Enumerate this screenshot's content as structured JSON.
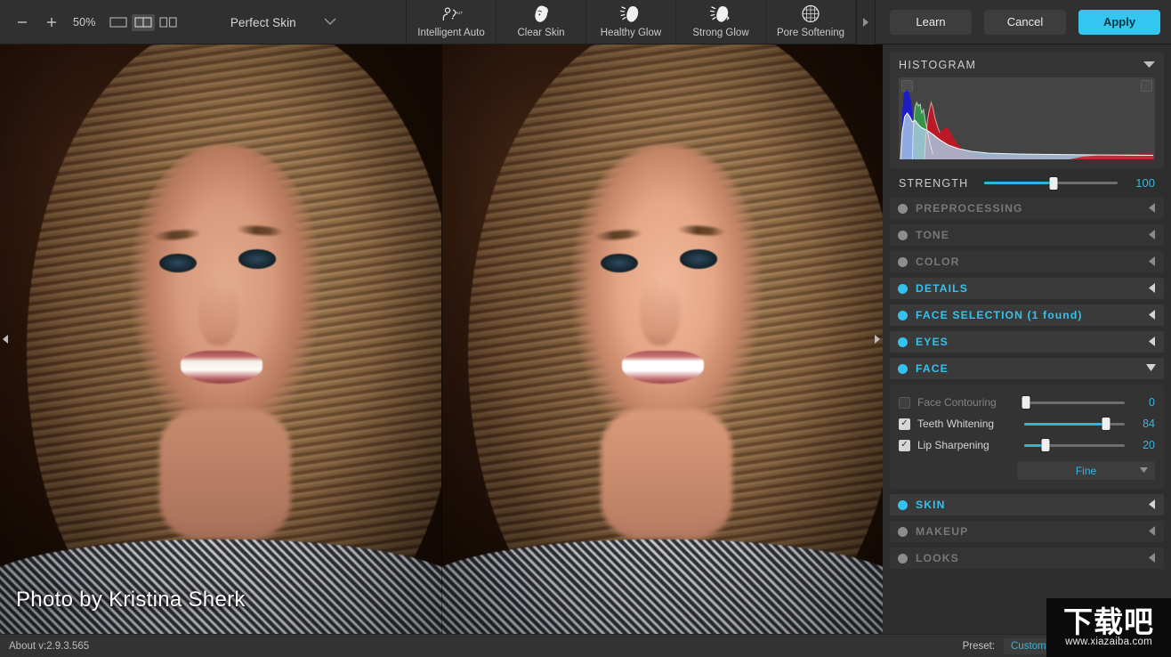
{
  "toolbar": {
    "zoom_out_icon": "minus-icon",
    "zoom_in_icon": "plus-icon",
    "zoom_level": "50%",
    "view_modes": [
      {
        "name": "single-view",
        "icon": "single-pane-icon",
        "active": false
      },
      {
        "name": "split-view",
        "icon": "split-pane-icon",
        "active": true
      },
      {
        "name": "side-by-side-view",
        "icon": "side-by-side-icon",
        "active": false
      }
    ],
    "preset_name": "Perfect Skin",
    "preset_chevron_icon": "chevron-down-icon",
    "tools": [
      {
        "label": "Intelligent Auto",
        "icon": "intelligent-auto-icon"
      },
      {
        "label": "Clear Skin",
        "icon": "clear-skin-icon"
      },
      {
        "label": "Healthy Glow",
        "icon": "healthy-glow-icon"
      },
      {
        "label": "Strong Glow",
        "icon": "strong-glow-icon"
      },
      {
        "label": "Pore Softening",
        "icon": "pore-softening-icon"
      }
    ],
    "tools_scroll_icon": "chevron-right-icon",
    "learn_label": "Learn",
    "cancel_label": "Cancel",
    "apply_label": "Apply",
    "accent_color": "#33c6f0"
  },
  "canvas": {
    "photo_credit": "Photo by Kristina Sherk",
    "left_collapse_icon": "chevron-left-icon",
    "right_collapse_icon": "chevron-right-icon"
  },
  "panel": {
    "histogram": {
      "title": "HISTOGRAM",
      "collapse_icon": "triangle-down-icon",
      "shadow_clip_icon": "shadow-clipping-toggle",
      "highlight_clip_icon": "highlight-clipping-toggle"
    },
    "strength": {
      "label": "STRENGTH",
      "value": "100",
      "percent": 52
    },
    "sections": [
      {
        "title": "PREPROCESSING",
        "enabled": false,
        "expanded": false
      },
      {
        "title": "TONE",
        "enabled": false,
        "expanded": false
      },
      {
        "title": "COLOR",
        "enabled": false,
        "expanded": false
      },
      {
        "title": "DETAILS",
        "enabled": true,
        "expanded": false
      },
      {
        "title": "FACE SELECTION (1 found)",
        "enabled": true,
        "expanded": false
      },
      {
        "title": "EYES",
        "enabled": true,
        "expanded": false
      },
      {
        "title": "FACE",
        "enabled": true,
        "expanded": true
      }
    ],
    "face_controls": [
      {
        "label": "Face Contouring",
        "checked": false,
        "value": "0",
        "percent": 0
      },
      {
        "label": "Teeth Whitening",
        "checked": true,
        "value": "84",
        "percent": 81
      },
      {
        "label": "Lip Sharpening",
        "checked": true,
        "value": "20",
        "percent": 21
      }
    ],
    "face_dropdown": {
      "value": "Fine",
      "arrow_icon": "triangle-down-icon"
    },
    "sections_bottom": [
      {
        "title": "SKIN",
        "enabled": true,
        "expanded": false
      },
      {
        "title": "MAKEUP",
        "enabled": false,
        "expanded": false
      },
      {
        "title": "LOOKS",
        "enabled": false,
        "expanded": false
      }
    ],
    "colors": {
      "accent": "#33c2ee",
      "disabled": "#777777"
    }
  },
  "status": {
    "about": "About v:2.9.3.565",
    "preset_key": "Preset:",
    "preset_value": "Custom"
  },
  "watermark": {
    "cn_text": "下载吧",
    "url": "www.xiazaiba.com"
  }
}
